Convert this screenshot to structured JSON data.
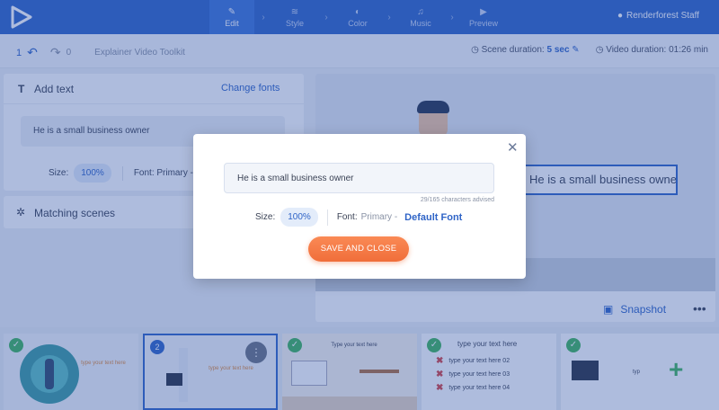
{
  "topbar": {
    "steps": [
      {
        "label": "Edit",
        "icon": "pencil-icon"
      },
      {
        "label": "Style",
        "icon": "layers-icon"
      },
      {
        "label": "Color",
        "icon": "palette-icon"
      },
      {
        "label": "Music",
        "icon": "music-icon"
      },
      {
        "label": "Preview",
        "icon": "play-icon"
      }
    ],
    "user": "Renderforest Staff",
    "accent": "#2f64c7"
  },
  "toolbar": {
    "undo_count": "1",
    "redo_count": "0",
    "project_title": "Explainer Video Toolkit",
    "scene_duration_label": "Scene duration:",
    "scene_duration_value": "5 sec",
    "video_duration_label": "Video duration: 01:26 min"
  },
  "add_text_panel": {
    "title": "Add text",
    "change_fonts": "Change fonts",
    "text_value": "He is a small business owner",
    "size_label": "Size:",
    "size_value": "100%",
    "font_label": "Font: Primary -"
  },
  "matching_panel": {
    "title": "Matching scenes"
  },
  "preview": {
    "scene_text": "He is a small business owner",
    "snapshot_label": "Snapshot",
    "more_label": "•••"
  },
  "filmstrip": {
    "thumb1_text": "type your text here",
    "thumb2_number": "2",
    "thumb2_text": "type your text here",
    "thumb3_text": "Type your text here",
    "thumb4_title": "type your text here",
    "thumb4_items": [
      "type your text here 02",
      "type your text here 03",
      "type your text here 04"
    ],
    "thumb5_text": "typ",
    "add_label": "+"
  },
  "modal": {
    "input_value": "He is a small business owner",
    "char_count": "29/165 characters advised",
    "size_label": "Size:",
    "size_value": "100%",
    "font_label": "Font:",
    "font_value": "Primary -",
    "default_font": "Default Font",
    "save_label": "SAVE AND CLOSE",
    "save_color": "#f06e3a"
  }
}
